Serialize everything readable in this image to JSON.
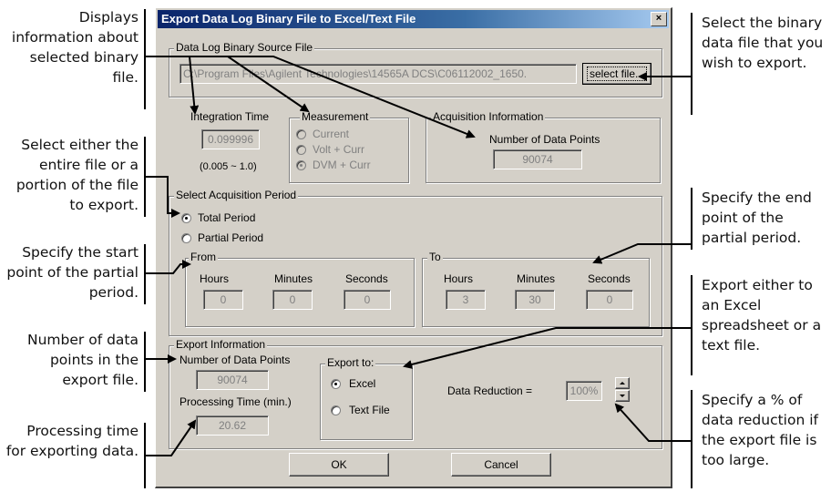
{
  "dialog": {
    "title": "Export Data Log Binary File to Excel/Text File",
    "close_label": "×",
    "source": {
      "legend": "Data Log Binary Source File",
      "path": "C:\\Program Files\\Agilent Technologies\\14565A DCS\\C06112002_1650.",
      "select_button": "select file..."
    },
    "integration": {
      "label": "Integration Time",
      "value": "0.099996",
      "range": "(0.005 ~ 1.0)"
    },
    "measurement": {
      "legend": "Measurement",
      "options": [
        "Current",
        "Volt + Curr",
        "DVM + Curr"
      ],
      "selected": "DVM + Curr"
    },
    "acquisition": {
      "legend": "Acquisition Information",
      "label": "Number of Data Points",
      "value": "90074"
    },
    "period": {
      "legend": "Select Acquisition Period",
      "total_label": "Total Period",
      "partial_label": "Partial Period",
      "from": {
        "legend": "From",
        "hours_label": "Hours",
        "minutes_label": "Minutes",
        "seconds_label": "Seconds",
        "hours": "0",
        "minutes": "0",
        "seconds": "0"
      },
      "to": {
        "legend": "To",
        "hours_label": "Hours",
        "minutes_label": "Minutes",
        "seconds_label": "Seconds",
        "hours": "3",
        "minutes": "30",
        "seconds": "0"
      }
    },
    "export": {
      "legend": "Export Information",
      "points_label": "Number of Data Points",
      "points_value": "90074",
      "time_label": "Processing Time (min.)",
      "time_value": "20.62",
      "export_to_legend": "Export to:",
      "excel_label": "Excel",
      "text_label": "Text File",
      "selected": "Excel",
      "reduction_label": "Data Reduction =",
      "reduction_value": "100%"
    },
    "ok_label": "OK",
    "cancel_label": "Cancel"
  },
  "callouts": {
    "left": [
      "Displays information about selected binary file.",
      "Select either the entire file or a portion of the file to export.",
      "Specify the start point of the partial period.",
      "Number of data points in the export file.",
      "Processing time for exporting data."
    ],
    "right": [
      "Select the binary data file that you wish to export.",
      "Specify the end point of the partial period.",
      "Export either to an Excel spreadsheet or a text file.",
      "Specify a % of data reduction if the export file is too large."
    ]
  },
  "colors": {
    "title_bar": "#0a246a",
    "dialog_bg": "#d4d0c8",
    "disabled_text": "#808080"
  }
}
